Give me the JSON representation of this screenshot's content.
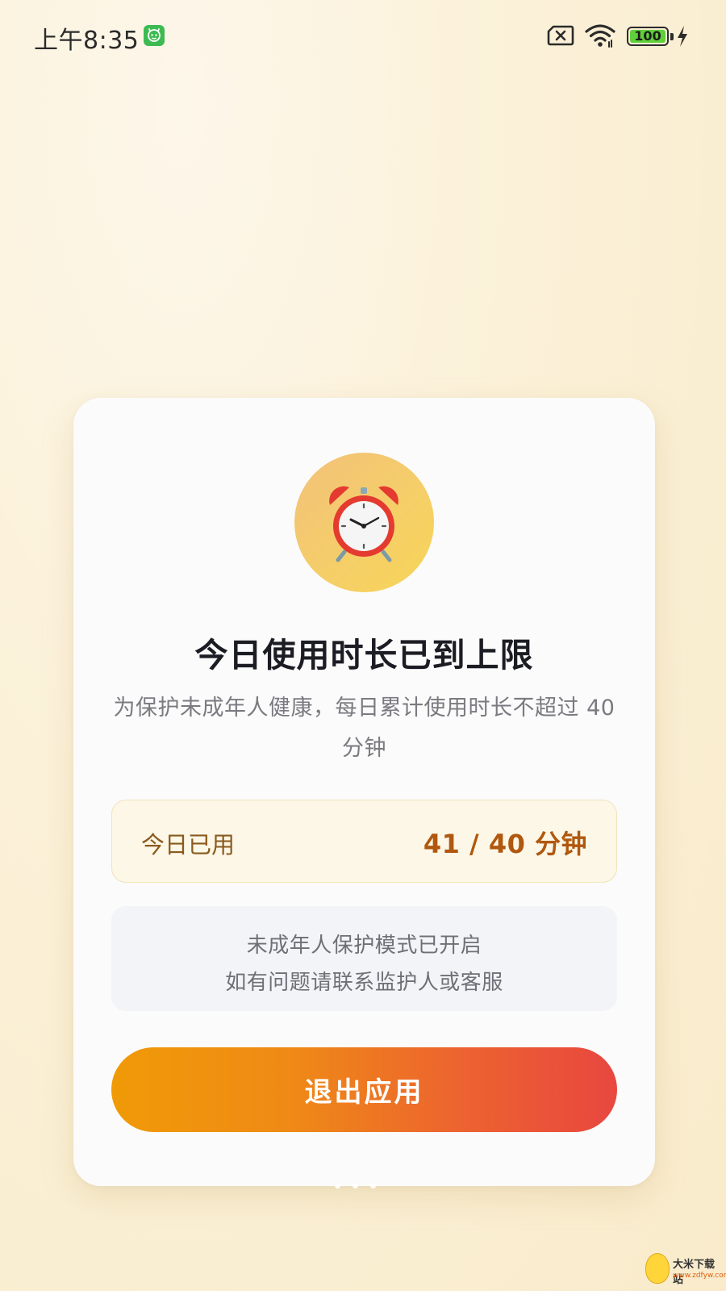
{
  "status_bar": {
    "time": "上午8:35",
    "battery_level": "100",
    "icons": [
      "app-badge-icon",
      "no-sim-icon",
      "wifi-icon",
      "battery-icon",
      "charging-icon"
    ]
  },
  "card": {
    "icon": "alarm-clock-icon",
    "title": "今日使用时长已到上限",
    "description": "为保护未成年人健康，每日累计使用时长不超过 40 分钟",
    "usage": {
      "label": "今日已用",
      "value": "41 / 40 分钟"
    },
    "notice": {
      "line1": "未成年人保护模式已开启",
      "line2": "如有问题请联系监护人或客服"
    },
    "exit_button_label": "退出应用"
  },
  "watermark": {
    "title": "大米下载站",
    "url": "www.zdfyw.com"
  },
  "colors": {
    "background": "#fbf1d8",
    "card": "#fbfbfb",
    "usage_value": "#b0580f",
    "button_gradient_start": "#f09a07",
    "button_gradient_end": "#e8473f",
    "battery": "#5fcf3a"
  }
}
